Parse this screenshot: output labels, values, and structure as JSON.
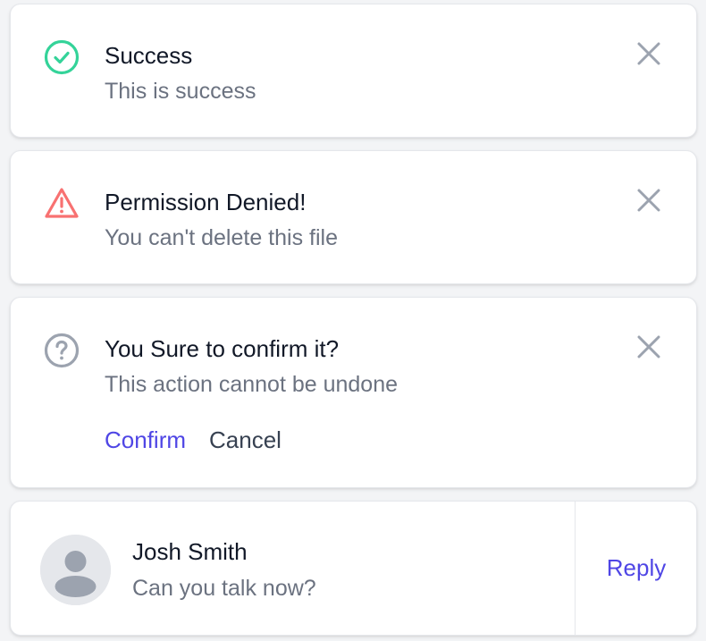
{
  "notifications": [
    {
      "type": "success",
      "icon": "check-circle-icon",
      "title": "Success",
      "message": "This is success",
      "color": "#34d399"
    },
    {
      "type": "error",
      "icon": "warning-triangle-icon",
      "title": "Permission Denied!",
      "message": "You can't delete this file",
      "color": "#f87171"
    },
    {
      "type": "confirm",
      "icon": "question-circle-icon",
      "title": "You Sure to confirm it?",
      "message": "This action cannot be undone",
      "color": "#9ca3af",
      "confirm_label": "Confirm",
      "cancel_label": "Cancel"
    }
  ],
  "message": {
    "sender": "Josh Smith",
    "text": "Can you talk now?",
    "reply_label": "Reply",
    "avatar_icon": "user-avatar-icon"
  },
  "colors": {
    "accent": "#4f46e5",
    "success": "#34d399",
    "danger": "#f87171",
    "muted": "#9ca3af"
  }
}
